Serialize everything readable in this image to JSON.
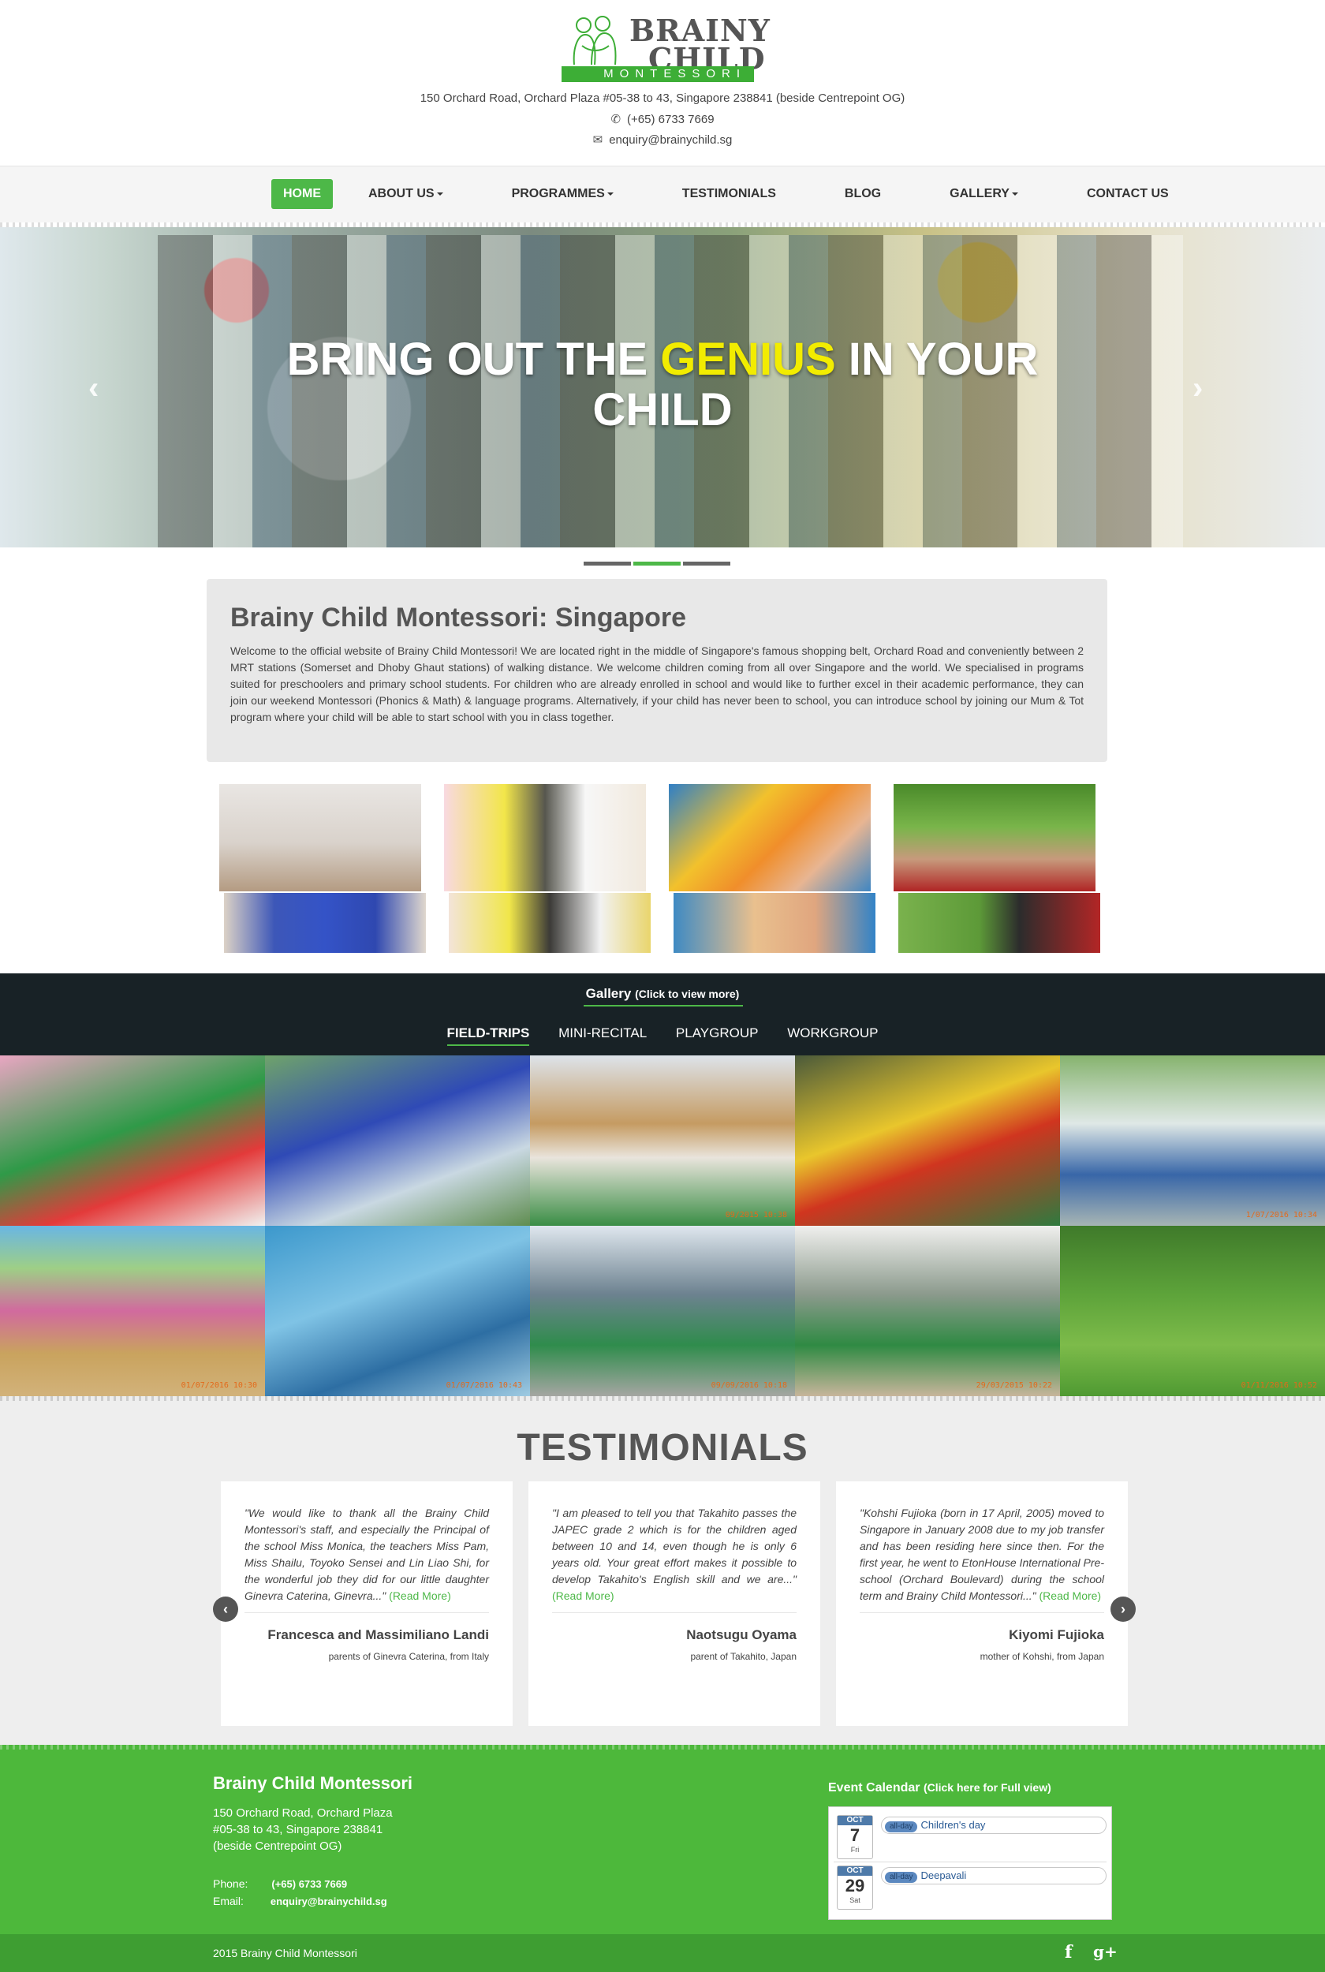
{
  "header": {
    "logo_line1": "BRAINY",
    "logo_line2": "CHILD",
    "logo_band": "MONTESSORI",
    "address": "150 Orchard Road, Orchard Plaza #05-38 to 43, Singapore 238841 (beside Centrepoint OG)",
    "phone": "(+65) 6733 7669",
    "email": "enquiry@brainychild.sg"
  },
  "nav": {
    "items": [
      {
        "label": "HOME"
      },
      {
        "label": "ABOUT US"
      },
      {
        "label": "PROGRAMMES"
      },
      {
        "label": "TESTIMONIALS"
      },
      {
        "label": "BLOG"
      },
      {
        "label": "GALLERY"
      },
      {
        "label": "CONTACT US"
      }
    ]
  },
  "hero": {
    "title_part1": "BRING OUT THE",
    "title_highlight": "GENIUS",
    "title_part2": "IN YOUR",
    "title_line2": "CHILD",
    "prev": "‹",
    "next": "›",
    "active_slide": 2,
    "slide_count": 3
  },
  "intro": {
    "title": "Brainy Child Montessori: Singapore",
    "body": "Welcome to the official website of Brainy Child Montessori! We are located right in the middle of Singapore's famous shopping belt, Orchard Road and conveniently between 2 MRT stations (Somerset and Dhoby Ghaut stations) of walking distance. We welcome children coming from all over Singapore and the world. We specialised in programs suited for preschoolers and primary school students. For children who are already enrolled in school and would like to further excel in their academic performance, they can join our weekend Montessori (Phonics & Math) & language programs. Alternatively, if your child has never been to school, you can introduce school by joining our Mum & Tot program where your child will be able to start school with you in class together."
  },
  "gallery": {
    "title": "Gallery",
    "subtitle": "(Click to view more)",
    "tabs": [
      "FIELD-TRIPS",
      "MINI-RECITAL",
      "PLAYGROUP",
      "WORKGROUP"
    ],
    "active_tab": "FIELD-TRIPS",
    "timestamps": [
      "",
      "",
      "09/2015 10:38",
      "",
      "1/07/2016 10:34",
      "01/07/2016 10:30",
      "01/07/2016 10:43",
      "09/09/2016 10:18",
      "29/03/2015 10:22",
      "01/11/2016 10:52"
    ]
  },
  "testimonials": {
    "title": "TESTIMONIALS",
    "prev": "‹",
    "next": "›",
    "items": [
      {
        "quote": "\"We would like to thank all the Brainy Child Montessori's staff, and especially the Principal of the school Miss Monica, the teachers Miss Pam, Miss Shailu, Toyoko Sensei and Lin Liao Shi, for the wonderful job they did for our little daughter Ginevra Caterina, Ginevra...\"",
        "read_more": "(Read More)",
        "name": "Francesca and Massimiliano Landi",
        "relation": "parents of Ginevra Caterina, from Italy"
      },
      {
        "quote": "\"I am pleased to tell you that Takahito passes the JAPEC grade 2 which is for the children aged between 10 and 14, even though he is only 6 years old. Your great effort makes it possible to develop Takahito's English skill and we are...\"",
        "read_more": "(Read More)",
        "name": "Naotsugu Oyama",
        "relation": "parent of Takahito, Japan"
      },
      {
        "quote": "\"Kohshi Fujioka (born in 17 April, 2005) moved to Singapore in January 2008 due to my job transfer and has been residing here since then. For the first year, he went to EtonHouse International Pre-school (Orchard Boulevard) during the school term and Brainy Child Montessori...\"",
        "read_more": "(Read More)",
        "name": "Kiyomi Fujioka",
        "relation": "mother of Kohshi, from Japan"
      }
    ]
  },
  "footer": {
    "title": "Brainy Child Montessori",
    "address_line1": "150 Orchard Road, Orchard Plaza",
    "address_line2": "#05-38 to 43, Singapore 238841",
    "address_line3": "(beside Centrepoint OG)",
    "phone_label": "Phone:",
    "phone": "(+65) 6733 7669",
    "email_label": "Email:",
    "email": "enquiry@brainychild.sg",
    "calendar_title": "Event Calendar",
    "calendar_sub": "(Click here for Full view)",
    "events": [
      {
        "month": "OCT",
        "day": "7",
        "weekday": "Fri",
        "tag": "all-day",
        "name": "Children's day"
      },
      {
        "month": "OCT",
        "day": "29",
        "weekday": "Sat",
        "tag": "all-day",
        "name": "Deepavali"
      }
    ],
    "copyright": "2015 Brainy Child Montessori",
    "social_facebook": "f",
    "social_google": "g+"
  },
  "colors": {
    "brand_green": "#4db848",
    "highlight_yellow": "#f2ec00",
    "dark_band": "#182226"
  }
}
